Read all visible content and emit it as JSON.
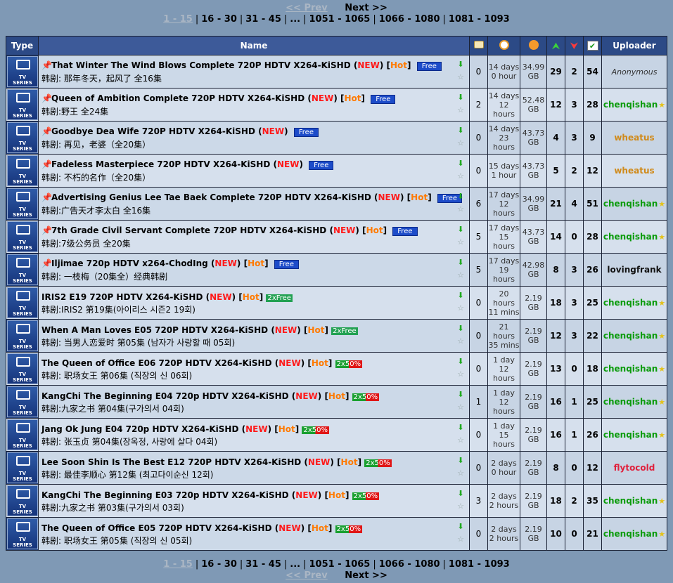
{
  "pager": {
    "prev": "<< Prev",
    "next": "Next >>",
    "current": "1 - 15",
    "pages": [
      "16 - 30",
      "31 - 45",
      "...",
      "1051 - 1065",
      "1066 - 1080",
      "1081 - 1093"
    ]
  },
  "header": {
    "type": "Type",
    "name": "Name",
    "comments_icon": "comment-icon",
    "time_icon": "clock-icon",
    "size_icon": "disk-icon",
    "seeders_icon": "up-arrows-icon",
    "leechers_icon": "down-arrows-icon",
    "completed_icon": "check-icon",
    "uploader": "Uploader"
  },
  "type_icon": {
    "line1": "TV",
    "line2": "SERIES"
  },
  "rows": [
    {
      "pinned": true,
      "title": "That Winter The Wind Blows Complete 720P HDTV X264-KiSHD",
      "new": "NEW",
      "hot": "Hot",
      "badge": "Free",
      "sub": "韩剧: 那年冬天，起风了 全16集",
      "comments": "0",
      "time1": "14 days",
      "time2": "0 hour",
      "size1": "34.99",
      "size2": "GB",
      "seeders": "29",
      "leechers": "2",
      "completed": "54",
      "uploader": "Anonymous",
      "uploader_style": "anon",
      "uploader_star": false
    },
    {
      "pinned": true,
      "title": "Queen of Ambition Complete 720P HDTV X264-KiSHD",
      "new": "NEW",
      "hot": "Hot",
      "badge": "Free",
      "sub": "韩剧:野王 全24集",
      "comments": "2",
      "time1": "14 days",
      "time2": "12 hours",
      "size1": "52.48",
      "size2": "GB",
      "seeders": "12",
      "leechers": "3",
      "completed": "28",
      "uploader": "chenqishan",
      "uploader_style": "green",
      "uploader_star": true
    },
    {
      "pinned": true,
      "title": "Goodbye Dea Wife 720P HDTV X264-KiSHD",
      "new": "NEW",
      "hot": "",
      "badge": "Free",
      "sub": "韩剧: 再见，老婆（全20集）",
      "comments": "0",
      "time1": "14 days",
      "time2": "23 hours",
      "size1": "43.73",
      "size2": "GB",
      "seeders": "4",
      "leechers": "3",
      "completed": "9",
      "uploader": "wheatus",
      "uploader_style": "orange",
      "uploader_star": false
    },
    {
      "pinned": true,
      "title": "Fadeless Masterpiece 720P HDTV X264-KiSHD",
      "new": "NEW",
      "hot": "",
      "badge": "Free",
      "sub": "韩剧: 不朽的名作（全20集）",
      "comments": "0",
      "time1": "15 days",
      "time2": "1 hour",
      "size1": "43.73",
      "size2": "GB",
      "seeders": "5",
      "leechers": "2",
      "completed": "12",
      "uploader": "wheatus",
      "uploader_style": "orange",
      "uploader_star": false
    },
    {
      "pinned": true,
      "title": "Advertising Genius Lee Tae Baek Complete 720P HDTV X264-KiSHD",
      "new": "NEW",
      "hot": "Hot",
      "badge": "Free",
      "sub": "韩剧:广告天才李太白 全16集",
      "comments": "6",
      "time1": "17 days",
      "time2": "12 hours",
      "size1": "34.99",
      "size2": "GB",
      "seeders": "21",
      "leechers": "4",
      "completed": "51",
      "uploader": "chenqishan",
      "uploader_style": "green",
      "uploader_star": true
    },
    {
      "pinned": true,
      "title": "7th Grade Civil Servant Complete 720P HDTV X264-KiSHD",
      "new": "NEW",
      "hot": "Hot",
      "badge": "Free",
      "sub": "韩剧:7级公务员 全20集",
      "comments": "5",
      "time1": "17 days",
      "time2": "15 hours",
      "size1": "43.73",
      "size2": "GB",
      "seeders": "14",
      "leechers": "0",
      "completed": "28",
      "uploader": "chenqishan",
      "uploader_style": "green",
      "uploader_star": true
    },
    {
      "pinned": true,
      "title": "Iljimae 720p HDTV x264-ChodIng",
      "new": "NEW",
      "hot": "Hot",
      "badge": "Free",
      "sub": "韩剧: 一枝梅（20集全）经典韩剧",
      "comments": "5",
      "time1": "17 days",
      "time2": "19 hours",
      "size1": "42.98",
      "size2": "GB",
      "seeders": "8",
      "leechers": "3",
      "completed": "26",
      "uploader": "lovingfrank",
      "uploader_style": "black",
      "uploader_star": false
    },
    {
      "pinned": false,
      "title": "IRIS2 E19 720P HDTV X264-KiSHD",
      "new": "NEW",
      "hot": "Hot",
      "badge": "2xFree",
      "sub": "韩剧:IRIS2 第19集(아이리스 시즌2 19회)",
      "comments": "0",
      "time1": "20 hours",
      "time2": "11 mins",
      "size1": "2.19",
      "size2": "GB",
      "seeders": "18",
      "leechers": "3",
      "completed": "25",
      "uploader": "chenqishan",
      "uploader_style": "green",
      "uploader_star": true
    },
    {
      "pinned": false,
      "title": "When A Man Loves E05 720P HDTV X264-KiSHD",
      "new": "NEW",
      "hot": "Hot",
      "badge": "2xFree",
      "sub": "韩剧: 当男人恋爱时 第05集 (남자가 사랑할 때 05회)",
      "comments": "0",
      "time1": "21 hours",
      "time2": "35 mins",
      "size1": "2.19",
      "size2": "GB",
      "seeders": "12",
      "leechers": "3",
      "completed": "22",
      "uploader": "chenqishan",
      "uploader_style": "green",
      "uploader_star": true
    },
    {
      "pinned": false,
      "title": "The Queen of Office E06 720P HDTV X264-KiSHD",
      "new": "NEW",
      "hot": "Hot",
      "badge": "2x50%",
      "sub": "韩剧: 职场女王 第06集 (직장의 신 06회)",
      "comments": "0",
      "time1": "1 day",
      "time2": "12 hours",
      "size1": "2.19",
      "size2": "GB",
      "seeders": "13",
      "leechers": "0",
      "completed": "18",
      "uploader": "chenqishan",
      "uploader_style": "green",
      "uploader_star": true
    },
    {
      "pinned": false,
      "title": "KangChi The Beginning E04 720p HDTV X264-KiSHD",
      "new": "NEW",
      "hot": "Hot",
      "badge": "2x50%",
      "sub": "韩剧:九家之书 第04集(구가의서 04회)",
      "comments": "1",
      "time1": "1 day",
      "time2": "12 hours",
      "size1": "2.19",
      "size2": "GB",
      "seeders": "16",
      "leechers": "1",
      "completed": "25",
      "uploader": "chenqishan",
      "uploader_style": "green",
      "uploader_star": true
    },
    {
      "pinned": false,
      "title": "Jang Ok Jung E04 720p HDTV X264-KiSHD",
      "new": "NEW",
      "hot": "Hot",
      "badge": "2x50%",
      "sub": "韩剧: 张玉贞 第04集(장옥정, 사랑에 살다 04회)",
      "comments": "0",
      "time1": "1 day",
      "time2": "15 hours",
      "size1": "2.19",
      "size2": "GB",
      "seeders": "16",
      "leechers": "1",
      "completed": "26",
      "uploader": "chenqishan",
      "uploader_style": "green",
      "uploader_star": true
    },
    {
      "pinned": false,
      "title": "Lee Soon Shin Is The Best E12 720P HDTV X264-KiSHD",
      "new": "NEW",
      "hot": "Hot",
      "badge": "2x50%",
      "sub": "韩剧: 最佳李顺心 第12集 (최고다이순신 12회)",
      "comments": "0",
      "time1": "2 days",
      "time2": "0 hour",
      "size1": "2.19",
      "size2": "GB",
      "seeders": "8",
      "leechers": "0",
      "completed": "12",
      "uploader": "flytocold",
      "uploader_style": "red",
      "uploader_star": false
    },
    {
      "pinned": false,
      "title": "KangChi The Beginning E03 720p HDTV X264-KiSHD",
      "new": "NEW",
      "hot": "Hot",
      "badge": "2x50%",
      "sub": "韩剧:九家之书 第03集(구가의서 03회)",
      "comments": "3",
      "time1": "2 days",
      "time2": "2 hours",
      "size1": "2.19",
      "size2": "GB",
      "seeders": "18",
      "leechers": "2",
      "completed": "35",
      "uploader": "chenqishan",
      "uploader_style": "green",
      "uploader_star": true
    },
    {
      "pinned": false,
      "title": "The Queen of Office E05 720P HDTV X264-KiSHD",
      "new": "NEW",
      "hot": "Hot",
      "badge": "2x50%",
      "sub": "韩剧: 职场女王 第05集 (직장의 신 05회)",
      "comments": "0",
      "time1": "2 days",
      "time2": "2 hours",
      "size1": "2.19",
      "size2": "GB",
      "seeders": "10",
      "leechers": "0",
      "completed": "21",
      "uploader": "chenqishan",
      "uploader_style": "green",
      "uploader_star": true
    }
  ]
}
